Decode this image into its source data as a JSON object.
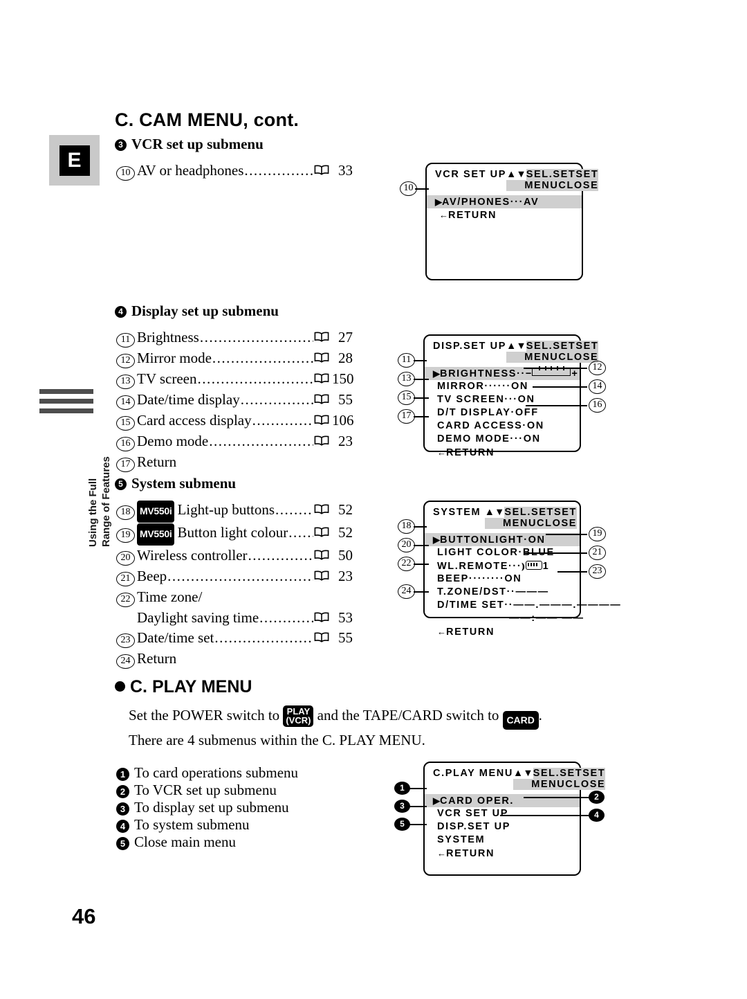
{
  "page": {
    "number": "46",
    "heading": "C. CAM MENU, cont.",
    "tab_letter": "E",
    "side_text_line1": "Using the Full",
    "side_text_line2": "Range of Features"
  },
  "section_vcr": {
    "bullet": "3",
    "title": "VCR set up submenu",
    "items": [
      {
        "num": "10",
        "label": "AV or headphones",
        "page": "33"
      }
    ]
  },
  "section_display": {
    "bullet": "4",
    "title": "Display set up submenu",
    "items": [
      {
        "num": "11",
        "label": "Brightness",
        "page": "27"
      },
      {
        "num": "12",
        "label": "Mirror mode",
        "page": "28"
      },
      {
        "num": "13",
        "label": "TV screen",
        "page": "150"
      },
      {
        "num": "14",
        "label": "Date/time display",
        "page": "55"
      },
      {
        "num": "15",
        "label": "Card access display",
        "page": "106"
      },
      {
        "num": "16",
        "label": "Demo mode",
        "page": "23"
      },
      {
        "num": "17",
        "label": "Return",
        "page": ""
      }
    ]
  },
  "section_system": {
    "bullet": "5",
    "title": "System submenu",
    "items": [
      {
        "num": "18",
        "badge": "MV550i",
        "label": "Light-up buttons",
        "page": "52"
      },
      {
        "num": "19",
        "badge": "MV550i",
        "label": "Button light colour",
        "page": "52"
      },
      {
        "num": "20",
        "badge": "",
        "label": "Wireless controller",
        "page": "50"
      },
      {
        "num": "21",
        "badge": "",
        "label": "Beep",
        "page": "23"
      },
      {
        "num": "22",
        "badge": "",
        "label": "Time zone/",
        "page": ""
      },
      {
        "num": "",
        "badge": "",
        "label": "Daylight saving time",
        "page": "53"
      },
      {
        "num": "23",
        "badge": "",
        "label": "Date/time set",
        "page": "55"
      },
      {
        "num": "24",
        "badge": "",
        "label": "Return",
        "page": ""
      }
    ]
  },
  "play_menu": {
    "title": "C. PLAY MENU",
    "para_a": "Set the POWER switch to",
    "key_play_line1": "PLAY",
    "key_play_line2": "(VCR)",
    "para_b": "and the TAPE/CARD switch to",
    "key_card": "CARD",
    "para_c": ".",
    "para_d": "There are 4 submenus within the C. PLAY MENU.",
    "items": [
      {
        "num": "1",
        "label": "To card operations submenu"
      },
      {
        "num": "2",
        "label": "To VCR set up submenu"
      },
      {
        "num": "3",
        "label": "To display set up submenu"
      },
      {
        "num": "4",
        "label": "To system submenu"
      },
      {
        "num": "5",
        "label": "Close main menu"
      }
    ]
  },
  "osd_vcr": {
    "title": "VCR SET UP",
    "hint1": "SEL.SETSET",
    "hint2": "MENUCLOSE",
    "rows": [
      {
        "text": "AV/PHONES···AV",
        "selected": true,
        "marker": "▶"
      },
      {
        "text": "RETURN",
        "selected": false,
        "marker": "←"
      }
    ],
    "callouts": [
      {
        "num": "10"
      }
    ]
  },
  "osd_disp": {
    "title": "DISP.SET UP",
    "hint1": "SEL.SETSET",
    "hint2": "MENUCLOSE",
    "rows": [
      {
        "text": "BRIGHTNESS··",
        "selected": true,
        "marker": "▶",
        "slider": true
      },
      {
        "text": "MIRROR······ON",
        "selected": false,
        "marker": ""
      },
      {
        "text": "TV SCREEN···ON",
        "selected": false,
        "marker": ""
      },
      {
        "text": "D/T DISPLAY·OFF",
        "selected": false,
        "marker": ""
      },
      {
        "text": "CARD ACCESS·ON",
        "selected": false,
        "marker": ""
      },
      {
        "text": "DEMO MODE···ON",
        "selected": false,
        "marker": ""
      },
      {
        "text": "RETURN",
        "selected": false,
        "marker": "←"
      }
    ],
    "callouts": [
      {
        "num": "11"
      },
      {
        "num": "12"
      },
      {
        "num": "13"
      },
      {
        "num": "14"
      },
      {
        "num": "15"
      },
      {
        "num": "16"
      },
      {
        "num": "17"
      }
    ]
  },
  "osd_system": {
    "title": "SYSTEM",
    "hint1": "SEL.SETSET",
    "hint2": "MENUCLOSE",
    "rows": [
      {
        "text": "BUTTONLIGHT·ON",
        "selected": true,
        "marker": "▶"
      },
      {
        "text": "LIGHT COLOR·BLUE",
        "selected": false,
        "marker": ""
      },
      {
        "text": "WL.REMOTE···",
        "selected": false,
        "marker": "",
        "remote": true,
        "suffix": "1"
      },
      {
        "text": "BEEP········ON",
        "selected": false,
        "marker": ""
      },
      {
        "text": "T.ZONE/DST··———",
        "selected": false,
        "marker": ""
      },
      {
        "text": "D/TIME SET··——.———.————",
        "selected": false,
        "marker": ""
      },
      {
        "text": "——:—— ——",
        "selected": false,
        "marker": "",
        "indent": true
      },
      {
        "text": "RETURN",
        "selected": false,
        "marker": "←"
      }
    ],
    "callouts": [
      {
        "num": "18"
      },
      {
        "num": "19"
      },
      {
        "num": "20"
      },
      {
        "num": "21"
      },
      {
        "num": "22"
      },
      {
        "num": "23"
      },
      {
        "num": "24"
      }
    ]
  },
  "osd_play": {
    "title": "C.PLAY MENU",
    "hint1": "SEL.SETSET",
    "hint2": "MENUCLOSE",
    "rows": [
      {
        "text": "CARD OPER.",
        "selected": true,
        "marker": "▶"
      },
      {
        "text": "VCR SET UP",
        "selected": false,
        "marker": ""
      },
      {
        "text": "DISP.SET UP",
        "selected": false,
        "marker": ""
      },
      {
        "text": "SYSTEM",
        "selected": false,
        "marker": ""
      },
      {
        "text": "RETURN",
        "selected": false,
        "marker": "←"
      }
    ],
    "callouts": [
      {
        "num": "1"
      },
      {
        "num": "2"
      },
      {
        "num": "3"
      },
      {
        "num": "4"
      },
      {
        "num": "5"
      }
    ]
  }
}
